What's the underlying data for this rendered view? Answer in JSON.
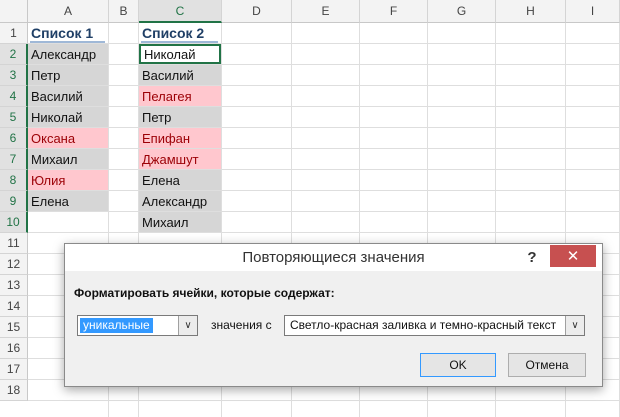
{
  "sheet": {
    "columns": [
      "A",
      "B",
      "C",
      "D",
      "E",
      "F",
      "G",
      "H",
      "I"
    ],
    "rows": [
      "1",
      "2",
      "3",
      "4",
      "5",
      "6",
      "7",
      "8",
      "9",
      "10",
      "11",
      "12",
      "13",
      "14",
      "15",
      "16",
      "17",
      "18"
    ],
    "list1_header": "Список 1",
    "list2_header": "Список 2",
    "list1": [
      "Александр",
      "Петр",
      "Василий",
      "Николай",
      "Оксана",
      "Михаил",
      "Юлия",
      "Елена"
    ],
    "list2": [
      "Николай",
      "Василий",
      "Пелагея",
      "Петр",
      "Епифан",
      "Джамшут",
      "Елена",
      "Александр",
      "Михаил"
    ],
    "colors": {
      "highlight_fill": "#ffc7ce",
      "highlight_text": "#9c0006",
      "gray_fill": "#d6d6d6",
      "accent": "#217346"
    }
  },
  "dialog": {
    "title": "Повторяющиеся значения",
    "help_glyph": "?",
    "close_glyph": "✕",
    "prompt": "Форматировать ячейки, которые содержат:",
    "rule_value": "уникальные",
    "values_label": "значения с",
    "format_value": "Светло-красная заливка и темно-красный текст",
    "dropdown_glyph": "∨",
    "ok_label": "OK",
    "cancel_label": "Отмена",
    "close_button_color": "#c75050"
  }
}
